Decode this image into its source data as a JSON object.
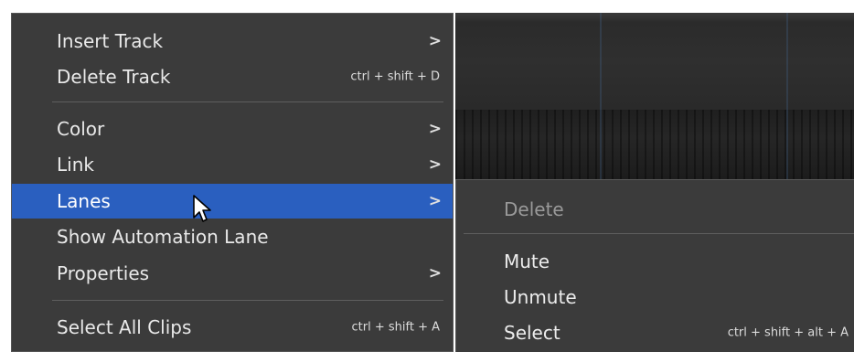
{
  "context_menu": {
    "items": [
      {
        "label": "Insert Track",
        "shortcut": "",
        "submenu": true
      },
      {
        "label": "Delete Track",
        "shortcut": "ctrl + shift + D",
        "submenu": false
      },
      {
        "label": "Color",
        "shortcut": "",
        "submenu": true
      },
      {
        "label": "Link",
        "shortcut": "",
        "submenu": true
      },
      {
        "label": "Lanes",
        "shortcut": "",
        "submenu": true,
        "highlighted": true
      },
      {
        "label": "Show Automation Lane",
        "shortcut": "",
        "submenu": false
      },
      {
        "label": "Properties",
        "shortcut": "",
        "submenu": true
      },
      {
        "label": "Select All Clips",
        "shortcut": "ctrl + shift + A",
        "submenu": false
      }
    ],
    "arrow_glyph": ">"
  },
  "lanes_submenu": {
    "items": [
      {
        "label": "Delete",
        "shortcut": "",
        "disabled": true
      },
      {
        "label": "Mute",
        "shortcut": ""
      },
      {
        "label": "Unmute",
        "shortcut": ""
      },
      {
        "label": "Select",
        "shortcut": "ctrl + shift + alt + A"
      }
    ]
  },
  "colors": {
    "menu_bg": "#3b3b3b",
    "highlight": "#2a5fbf",
    "text": "#e9e9e9",
    "disabled_text": "#9a9a9a"
  }
}
